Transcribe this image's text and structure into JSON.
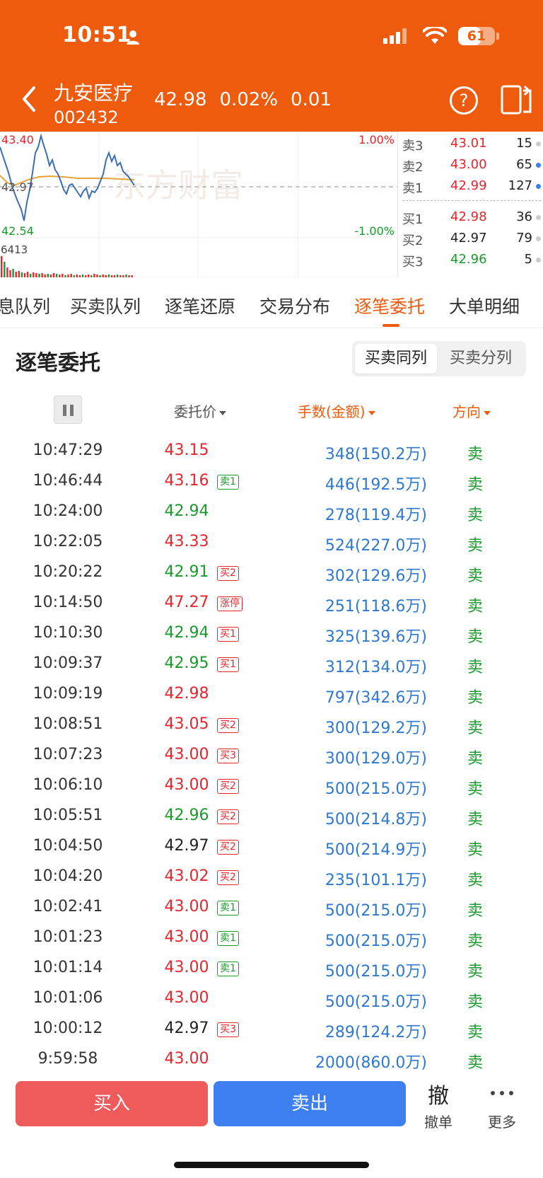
{
  "status": {
    "time": "10:51",
    "battery": "61",
    "battery_level_percent": 61
  },
  "header": {
    "name": "九安医疗",
    "code": "002432",
    "price": "42.98",
    "change_pct": "0.02%",
    "change": "0.01"
  },
  "mini_chart": {
    "high": "43.40",
    "mid": "42.97",
    "low": "42.54",
    "pct_top": "1.00%",
    "pct_bottom": "-1.00%",
    "volume": "6413",
    "watermark": "东方财富"
  },
  "orderbook": {
    "asks": [
      {
        "label": "卖3",
        "price": "43.01",
        "vol": "15",
        "dot": "#cccccc"
      },
      {
        "label": "卖2",
        "price": "43.00",
        "vol": "65",
        "dot": "#3D7FEF"
      },
      {
        "label": "卖1",
        "price": "42.99",
        "vol": "127",
        "dot": "#3D7FEF"
      }
    ],
    "bids": [
      {
        "label": "买1",
        "price": "42.98",
        "vol": "36",
        "dot": "#cccccc"
      },
      {
        "label": "买2",
        "price": "42.97",
        "vol": "79",
        "dot": "#cccccc"
      },
      {
        "label": "买3",
        "price": "42.96",
        "vol": "5",
        "dot": "#cccccc"
      }
    ]
  },
  "tabs": [
    "息队列",
    "买卖队列",
    "逐笔还原",
    "交易分布",
    "逐笔委托",
    "大单明细"
  ],
  "active_tab": "逐笔委托",
  "section": {
    "title": "逐笔委托",
    "seg_on": "买卖同列",
    "seg_off": "买卖分列"
  },
  "columns": {
    "price": "委托价",
    "volume": "手数(金额)",
    "direction": "方向"
  },
  "colors": {
    "accent": "#EE5B0C",
    "up": "#E8252C",
    "down": "#1A9A2C",
    "neutral": "#222222",
    "volume": "#2E78D0"
  },
  "rows": [
    {
      "time": "10:47:29",
      "price": "43.15",
      "pc": "up",
      "tag": "",
      "tc": "",
      "vol": "348(150.2万)",
      "dir": "卖"
    },
    {
      "time": "10:46:44",
      "price": "43.16",
      "pc": "up",
      "tag": "卖1",
      "tc": "down",
      "vol": "446(192.5万)",
      "dir": "卖"
    },
    {
      "time": "10:24:00",
      "price": "42.94",
      "pc": "down",
      "tag": "",
      "tc": "",
      "vol": "278(119.4万)",
      "dir": "卖"
    },
    {
      "time": "10:22:05",
      "price": "43.33",
      "pc": "up",
      "tag": "",
      "tc": "",
      "vol": "524(227.0万)",
      "dir": "卖"
    },
    {
      "time": "10:20:22",
      "price": "42.91",
      "pc": "down",
      "tag": "买2",
      "tc": "up",
      "vol": "302(129.6万)",
      "dir": "卖"
    },
    {
      "time": "10:14:50",
      "price": "47.27",
      "pc": "up",
      "tag": "涨停",
      "tc": "up",
      "vol": "251(118.6万)",
      "dir": "卖"
    },
    {
      "time": "10:10:30",
      "price": "42.94",
      "pc": "down",
      "tag": "买1",
      "tc": "up",
      "vol": "325(139.6万)",
      "dir": "卖"
    },
    {
      "time": "10:09:37",
      "price": "42.95",
      "pc": "down",
      "tag": "买1",
      "tc": "up",
      "vol": "312(134.0万)",
      "dir": "卖"
    },
    {
      "time": "10:09:19",
      "price": "42.98",
      "pc": "up",
      "tag": "",
      "tc": "",
      "vol": "797(342.6万)",
      "dir": "卖"
    },
    {
      "time": "10:08:51",
      "price": "43.05",
      "pc": "up",
      "tag": "买2",
      "tc": "up",
      "vol": "300(129.2万)",
      "dir": "卖"
    },
    {
      "time": "10:07:23",
      "price": "43.00",
      "pc": "up",
      "tag": "买3",
      "tc": "up",
      "vol": "300(129.0万)",
      "dir": "卖"
    },
    {
      "time": "10:06:10",
      "price": "43.00",
      "pc": "up",
      "tag": "买2",
      "tc": "up",
      "vol": "500(215.0万)",
      "dir": "卖"
    },
    {
      "time": "10:05:51",
      "price": "42.96",
      "pc": "down",
      "tag": "买2",
      "tc": "up",
      "vol": "500(214.8万)",
      "dir": "卖"
    },
    {
      "time": "10:04:50",
      "price": "42.97",
      "pc": "neutral",
      "tag": "买2",
      "tc": "up",
      "vol": "500(214.9万)",
      "dir": "卖"
    },
    {
      "time": "10:04:20",
      "price": "43.02",
      "pc": "up",
      "tag": "买2",
      "tc": "up",
      "vol": "235(101.1万)",
      "dir": "卖"
    },
    {
      "time": "10:02:41",
      "price": "43.00",
      "pc": "up",
      "tag": "卖1",
      "tc": "down",
      "vol": "500(215.0万)",
      "dir": "卖"
    },
    {
      "time": "10:01:23",
      "price": "43.00",
      "pc": "up",
      "tag": "卖1",
      "tc": "down",
      "vol": "500(215.0万)",
      "dir": "卖"
    },
    {
      "time": "10:01:14",
      "price": "43.00",
      "pc": "up",
      "tag": "卖1",
      "tc": "down",
      "vol": "500(215.0万)",
      "dir": "卖"
    },
    {
      "time": "10:01:06",
      "price": "43.00",
      "pc": "up",
      "tag": "",
      "tc": "",
      "vol": "500(215.0万)",
      "dir": "卖"
    },
    {
      "time": "10:00:12",
      "price": "42.97",
      "pc": "neutral",
      "tag": "买3",
      "tc": "up",
      "vol": "289(124.2万)",
      "dir": "卖"
    },
    {
      "time": "9:59:58",
      "price": "43.00",
      "pc": "up",
      "tag": "",
      "tc": "",
      "vol": "2000(860.0万)",
      "dir": "卖"
    }
  ],
  "bottom": {
    "buy": "买入",
    "sell": "卖出",
    "cancel_icon": "撤",
    "cancel": "撤单",
    "more": "更多"
  }
}
